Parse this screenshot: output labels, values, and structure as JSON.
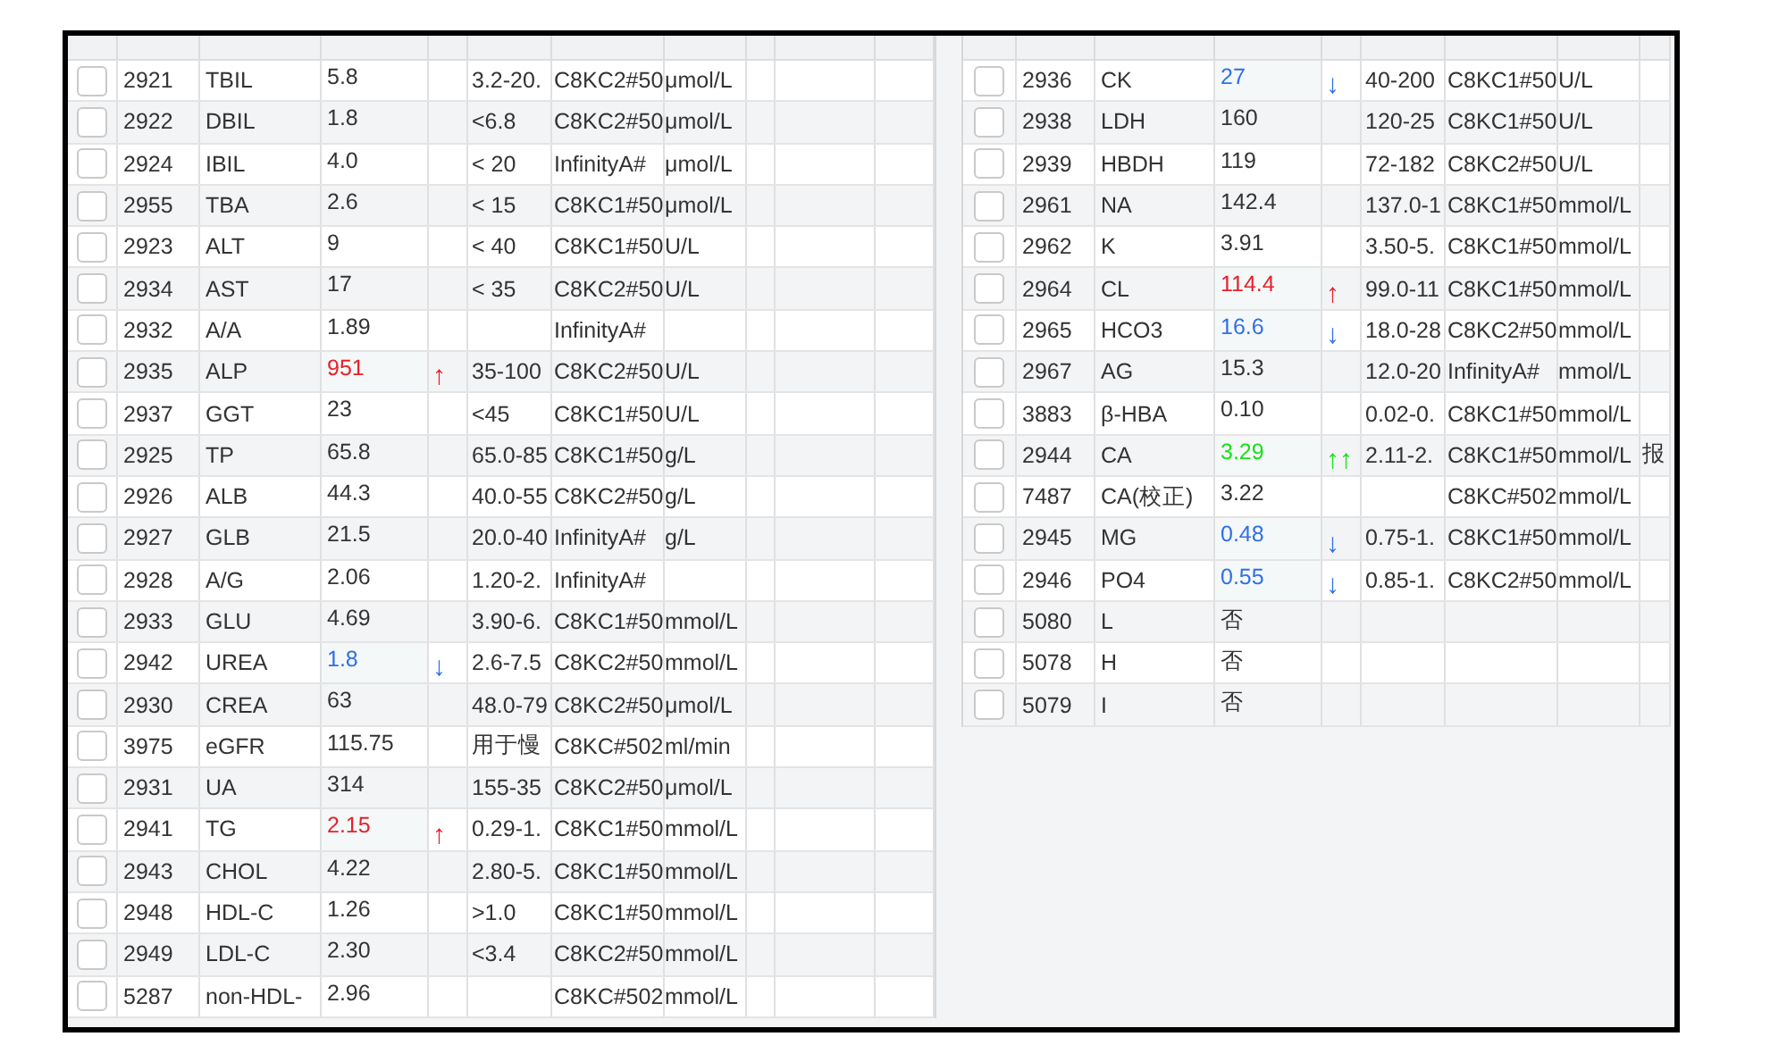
{
  "left_table": {
    "rows": [
      {
        "checked": false,
        "id": "2921",
        "name": "TBIL",
        "result": "5.8",
        "color": "#333333",
        "range": "3.2-20.",
        "instrument": "C8KC2#50",
        "unit": "μmol/L"
      },
      {
        "checked": false,
        "id": "2922",
        "name": "DBIL",
        "result": "1.8",
        "color": "#333333",
        "range": "<6.8",
        "instrument": "C8KC2#50",
        "unit": "μmol/L"
      },
      {
        "checked": false,
        "id": "2924",
        "name": "IBIL",
        "result": "4.0",
        "color": "#333333",
        "range": "< 20",
        "instrument": "InfinityA#",
        "unit": "μmol/L"
      },
      {
        "checked": false,
        "id": "2955",
        "name": "TBA",
        "result": "2.6",
        "color": "#333333",
        "range": "< 15",
        "instrument": "C8KC1#50",
        "unit": "μmol/L"
      },
      {
        "checked": false,
        "id": "2923",
        "name": "ALT",
        "result": "9",
        "color": "#333333",
        "range": "< 40",
        "instrument": "C8KC1#50",
        "unit": "U/L"
      },
      {
        "checked": false,
        "id": "2934",
        "name": "AST",
        "result": "17",
        "color": "#333333",
        "range": "< 35",
        "instrument": "C8KC2#50",
        "unit": "U/L"
      },
      {
        "checked": false,
        "id": "2932",
        "name": "A/A",
        "result": "1.89",
        "color": "#333333",
        "instrument": "InfinityA#"
      },
      {
        "checked": false,
        "id": "2935",
        "name": "ALP",
        "result": "951",
        "color": "#e8202a",
        "flag": "↑",
        "range": "35-100",
        "instrument": "C8KC2#50",
        "unit": "U/L"
      },
      {
        "checked": false,
        "id": "2937",
        "name": "GGT",
        "result": "23",
        "color": "#333333",
        "range": "<45",
        "instrument": "C8KC1#50",
        "unit": "U/L"
      },
      {
        "checked": false,
        "id": "2925",
        "name": "TP",
        "result": "65.8",
        "color": "#333333",
        "range": "65.0-85",
        "instrument": "C8KC1#50",
        "unit": "g/L"
      },
      {
        "checked": false,
        "id": "2926",
        "name": "ALB",
        "result": "44.3",
        "color": "#333333",
        "range": "40.0-55",
        "instrument": "C8KC2#50",
        "unit": "g/L"
      },
      {
        "checked": false,
        "id": "2927",
        "name": "GLB",
        "result": "21.5",
        "color": "#333333",
        "range": "20.0-40",
        "instrument": "InfinityA#",
        "unit": "g/L"
      },
      {
        "checked": false,
        "id": "2928",
        "name": "A/G",
        "result": "2.06",
        "color": "#333333",
        "range": "1.20-2.",
        "instrument": "InfinityA#"
      },
      {
        "checked": false,
        "id": "2933",
        "name": "GLU",
        "result": "4.69",
        "color": "#333333",
        "range": "3.90-6.",
        "instrument": "C8KC1#50",
        "unit": "mmol/L"
      },
      {
        "checked": false,
        "id": "2942",
        "name": "UREA",
        "result": "1.8",
        "color": "#2f6fe8",
        "flag": "↓",
        "range": "2.6-7.5",
        "instrument": "C8KC2#50",
        "unit": "mmol/L"
      },
      {
        "checked": false,
        "id": "2930",
        "name": "CREA",
        "result": "63",
        "color": "#333333",
        "range": "48.0-79",
        "instrument": "C8KC2#50",
        "unit": "μmol/L"
      },
      {
        "checked": false,
        "id": "3975",
        "name": "eGFR",
        "result": "115.75",
        "color": "#333333",
        "range": "用于慢",
        "instrument": "C8KC#502",
        "unit": "ml/min"
      },
      {
        "checked": false,
        "id": "2931",
        "name": "UA",
        "result": "314",
        "color": "#333333",
        "range": "155-35",
        "instrument": "C8KC2#50",
        "unit": "μmol/L"
      },
      {
        "checked": false,
        "id": "2941",
        "name": "TG",
        "result": "2.15",
        "color": "#e8202a",
        "flag": "↑",
        "range": "0.29-1.",
        "instrument": "C8KC1#50",
        "unit": "mmol/L"
      },
      {
        "checked": false,
        "id": "2943",
        "name": "CHOL",
        "result": "4.22",
        "color": "#333333",
        "range": "2.80-5.",
        "instrument": "C8KC1#50",
        "unit": "mmol/L"
      },
      {
        "checked": false,
        "id": "2948",
        "name": "HDL-C",
        "result": "1.26",
        "color": "#333333",
        "range": ">1.0",
        "instrument": "C8KC1#50",
        "unit": "mmol/L"
      },
      {
        "checked": false,
        "id": "2949",
        "name": "LDL-C",
        "result": "2.30",
        "color": "#333333",
        "range": "<3.4",
        "instrument": "C8KC2#50",
        "unit": "mmol/L"
      },
      {
        "checked": false,
        "id": "5287",
        "name": "non-HDL-",
        "result": "2.96",
        "color": "#333333",
        "instrument": "C8KC#502",
        "unit": "mmol/L"
      }
    ]
  },
  "right_table": {
    "rows": [
      {
        "checked": false,
        "id": "2936",
        "name": "CK",
        "result": "27",
        "color": "#2f6fe8",
        "flag": "↓",
        "range": "40-200",
        "instrument": "C8KC1#50",
        "unit": "U/L"
      },
      {
        "checked": false,
        "id": "2938",
        "name": "LDH",
        "result": "160",
        "color": "#333333",
        "range": "120-25",
        "instrument": "C8KC1#50",
        "unit": "U/L"
      },
      {
        "checked": false,
        "id": "2939",
        "name": "HBDH",
        "result": "119",
        "color": "#333333",
        "range": "72-182",
        "instrument": "C8KC2#50",
        "unit": "U/L"
      },
      {
        "checked": false,
        "id": "2961",
        "name": "NA",
        "result": "142.4",
        "color": "#333333",
        "range": "137.0-1",
        "instrument": "C8KC1#50",
        "unit": "mmol/L"
      },
      {
        "checked": false,
        "id": "2962",
        "name": "K",
        "result": "3.91",
        "color": "#333333",
        "range": "3.50-5.",
        "instrument": "C8KC1#50",
        "unit": "mmol/L"
      },
      {
        "checked": false,
        "id": "2964",
        "name": "CL",
        "result": "114.4",
        "color": "#e8202a",
        "flag": "↑",
        "range": "99.0-11",
        "instrument": "C8KC1#50",
        "unit": "mmol/L"
      },
      {
        "checked": false,
        "id": "2965",
        "name": "HCO3",
        "result": "16.6",
        "color": "#2f6fe8",
        "flag": "↓",
        "range": "18.0-28",
        "instrument": "C8KC2#50",
        "unit": "mmol/L"
      },
      {
        "checked": false,
        "id": "2967",
        "name": "AG",
        "result": "15.3",
        "color": "#333333",
        "range": "12.0-20",
        "instrument": "InfinityA#",
        "unit": "mmol/L"
      },
      {
        "checked": false,
        "id": "3883",
        "name": "β-HBA",
        "result": "0.10",
        "color": "#333333",
        "range": "0.02-0.",
        "instrument": "C8KC1#50",
        "unit": "mmol/L"
      },
      {
        "checked": false,
        "id": "2944",
        "name": "CA",
        "result": "3.29",
        "color": "#18e018",
        "flag": "↑↑",
        "range": "2.11-2.",
        "instrument": "C8KC1#50",
        "unit": "mmol/L",
        "note": "报"
      },
      {
        "checked": false,
        "id": "7487",
        "name": "CA(校正)",
        "result": "3.22",
        "color": "#333333",
        "instrument": "C8KC#502",
        "unit": "mmol/L"
      },
      {
        "checked": false,
        "id": "2945",
        "name": "MG",
        "result": "0.48",
        "color": "#2f6fe8",
        "flag": "↓",
        "range": "0.75-1.",
        "instrument": "C8KC1#50",
        "unit": "mmol/L"
      },
      {
        "checked": false,
        "id": "2946",
        "name": "PO4",
        "result": "0.55",
        "color": "#2f6fe8",
        "flag": "↓",
        "range": "0.85-1.",
        "instrument": "C8KC2#50",
        "unit": "mmol/L"
      },
      {
        "checked": false,
        "id": "5080",
        "name": "L",
        "result": "否",
        "color": "#333333"
      },
      {
        "checked": false,
        "id": "5078",
        "name": "H",
        "result": "否",
        "color": "#333333"
      },
      {
        "checked": false,
        "id": "5079",
        "name": "I",
        "result": "否",
        "color": "#333333"
      }
    ]
  }
}
